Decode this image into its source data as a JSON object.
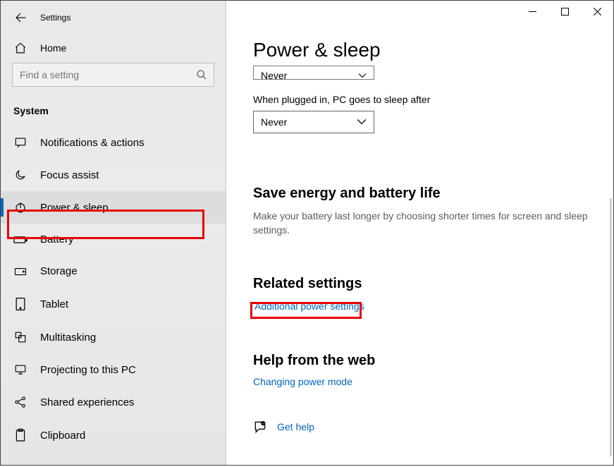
{
  "window": {
    "title": "Settings"
  },
  "sidebar": {
    "home_label": "Home",
    "search_placeholder": "Find a setting",
    "group_label": "System",
    "items": [
      {
        "label": "Notifications & actions"
      },
      {
        "label": "Focus assist"
      },
      {
        "label": "Power & sleep"
      },
      {
        "label": "Battery"
      },
      {
        "label": "Storage"
      },
      {
        "label": "Tablet"
      },
      {
        "label": "Multitasking"
      },
      {
        "label": "Projecting to this PC"
      },
      {
        "label": "Shared experiences"
      },
      {
        "label": "Clipboard"
      }
    ]
  },
  "main": {
    "page_title": "Power & sleep",
    "truncated_dropdown_value": "Never",
    "sleep_plugged_label": "When plugged in, PC goes to sleep after",
    "sleep_plugged_value": "Never",
    "energy_heading": "Save energy and battery life",
    "energy_text": "Make your battery last longer by choosing shorter times for screen and sleep settings.",
    "related_heading": "Related settings",
    "related_link": "Additional power settings",
    "help_heading": "Help from the web",
    "help_link": "Changing power mode",
    "get_help_label": "Get help"
  }
}
